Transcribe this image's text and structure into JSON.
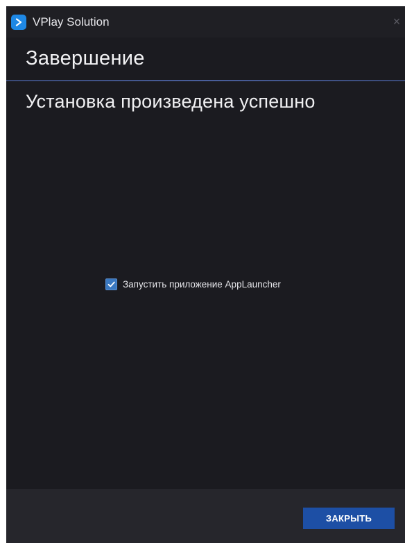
{
  "window": {
    "title": "VPlay Solution",
    "close_glyph": "×"
  },
  "header": {
    "title": "Завершение"
  },
  "main": {
    "status": "Установка произведена успешно",
    "launch_checkbox": {
      "label": "Запустить приложение AppLauncher",
      "checked": true
    }
  },
  "footer": {
    "close_label": "ЗАКРЫТЬ"
  },
  "icons": {
    "app": "play-arrow-icon",
    "close": "close-icon",
    "check": "checkmark-icon"
  },
  "colors": {
    "accent": "#1d4fa5",
    "checkbox": "#3a78c0",
    "background": "#1b1b20"
  }
}
